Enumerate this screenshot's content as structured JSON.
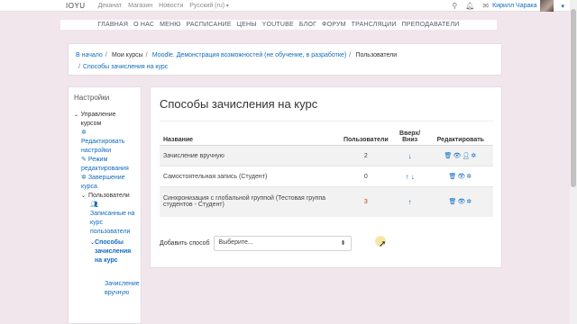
{
  "topbar": {
    "brand": "IOYU",
    "nav": [
      "Деканат",
      "Магазин",
      "Новости",
      "Русский (ru)"
    ],
    "bell_icon": "bell-icon",
    "search_icon": "search-icon",
    "message_icon": "chat-icon",
    "user_name": "Кирилл Чарака",
    "caret": "▾"
  },
  "menu": [
    "ГЛАВНАЯ",
    "О НАС",
    "МЕНЮ",
    "РАСПИСАНИЕ",
    "ЦЕНЫ",
    "YOUTUBE",
    "БЛОГ",
    "ФОРУМ",
    "ТРАНСЛЯЦИИ",
    "ПРЕПОДАВАТЕЛИ"
  ],
  "breadcrumb": {
    "items": [
      {
        "label": "В начало",
        "link": true
      },
      {
        "label": "Мои курсы",
        "link": false
      },
      {
        "label": "Moodle. Демонстрация возможностей (не обучение, в разработке)",
        "link": true
      },
      {
        "label": "Пользователи",
        "link": false
      },
      {
        "label": "Способы зачисления на курс",
        "link": true
      }
    ]
  },
  "settings": {
    "title": "Настройки",
    "course_admin": "Управление курсом",
    "edit_settings": "Редактировать настройки",
    "edit_mode": "Режим редактирования",
    "complete_course": "Завершение курса",
    "users": "Пользователи",
    "enrolled_users": "Записанные на курс пользователи",
    "enrol_methods": "Способы зачисления на курс",
    "manual_enrol": "Зачисление вручную"
  },
  "main": {
    "title": "Способы зачисления на курс",
    "headers": {
      "name": "Название",
      "users": "Пользователи",
      "updown": "Вверх/ Вниз",
      "edit": "Редактировать"
    },
    "rows": [
      {
        "name": "Зачисление вручную",
        "users": "2",
        "arrows": "↓"
      },
      {
        "name": "Самостоятельная запись (Студент)",
        "users": "0",
        "arrows": "↑ ↓"
      },
      {
        "name": "Синхронизация с глобальной группой (Тестовая группа студентов - Студент)",
        "users": "3",
        "arrows": "↑"
      }
    ],
    "add_label": "Добавить способ",
    "select_value": "Выберите..."
  }
}
